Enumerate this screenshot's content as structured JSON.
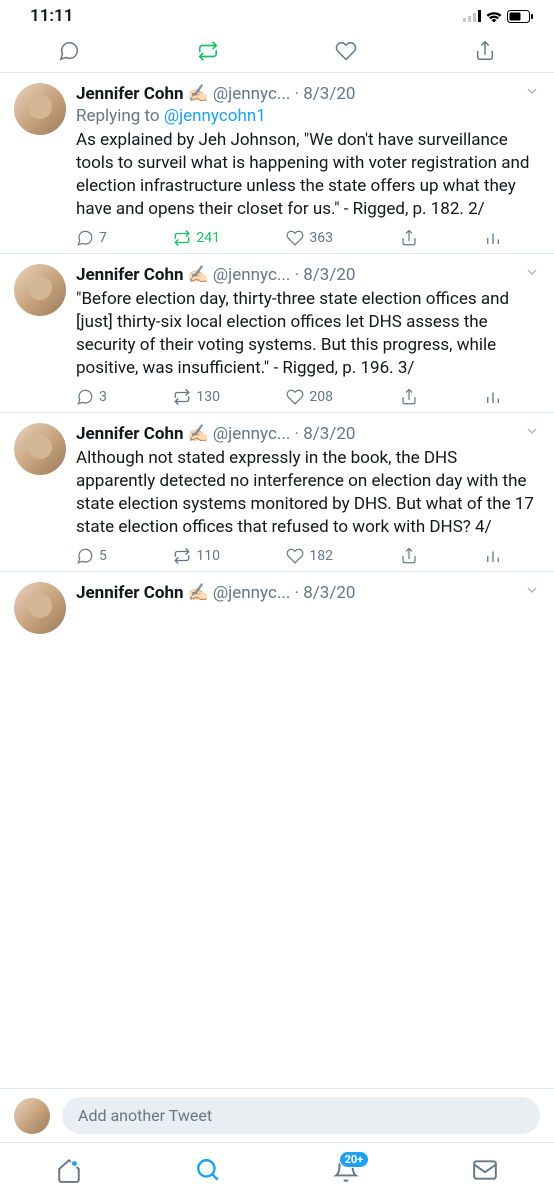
{
  "status_bar": {
    "time": "11:11"
  },
  "tweets": [
    {
      "name": "Jennifer Cohn ✍🏻",
      "handle_date": "@jennyc... · 8/3/20",
      "replying_prefix": "Replying to ",
      "replying_mention": "@jennycohn1",
      "text": "As explained by Jeh Johnson, \"We don't have surveillance tools to surveil what is happening with voter registration and election infrastructure unless the state offers up what they have and opens their closet for us.\" - Rigged, p. 182. 2/",
      "replies": "7",
      "retweets": "241",
      "likes": "363",
      "rt_active": true
    },
    {
      "name": "Jennifer Cohn ✍🏻",
      "handle_date": "@jennyc... · 8/3/20",
      "text": "\"Before election day, thirty-three state election offices and [just] thirty-six local election offices let DHS assess the security of their voting systems. But this progress, while positive, was insufficient.\" - Rigged, p. 196. 3/",
      "replies": "3",
      "retweets": "130",
      "likes": "208",
      "rt_active": false
    },
    {
      "name": "Jennifer Cohn ✍🏻",
      "handle_date": "@jennyc... · 8/3/20",
      "text": "Although not stated expressly in the book, the DHS apparently detected no interference on election day with the state election systems monitored by DHS. But what of the 17 state election offices that refused to work with DHS? 4/",
      "replies": "5",
      "retweets": "110",
      "likes": "182",
      "rt_active": false
    },
    {
      "name": "Jennifer Cohn ✍🏻",
      "handle_date": "@jennyc... · 8/3/20"
    }
  ],
  "compose": {
    "placeholder": "Add another Tweet"
  },
  "bottom_nav": {
    "badge": "20+"
  }
}
